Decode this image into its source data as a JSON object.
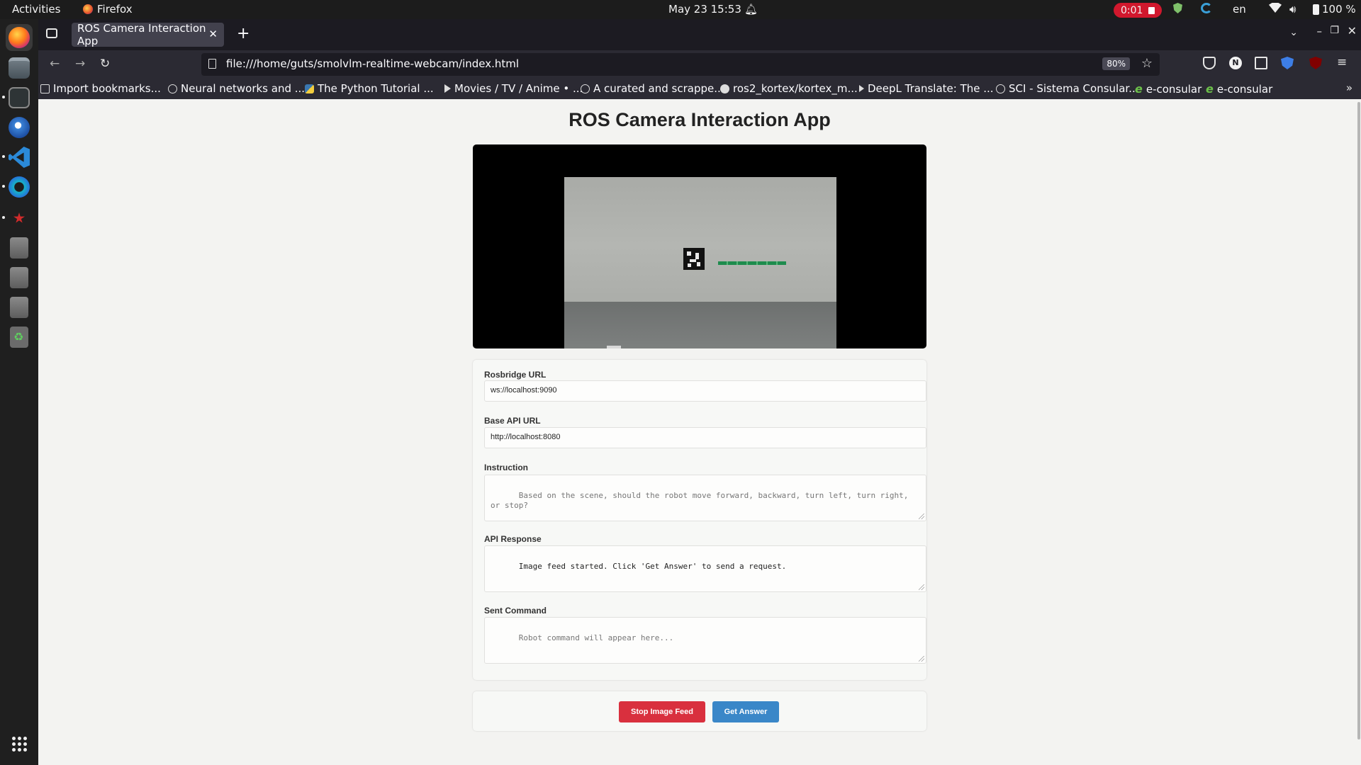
{
  "system": {
    "activities": "Activities",
    "app_name": "Firefox",
    "clock": "May 23  15:53",
    "recording": "0:01",
    "language": "en",
    "battery": "100 %"
  },
  "browser": {
    "tab_title": "ROS Camera Interaction App",
    "url": "file:///home/guts/smolvlm-realtime-webcam/index.html",
    "zoom": "80%",
    "ext_n": "N",
    "bookmarks": [
      "Import bookmarks...",
      "Neural networks and ...",
      "The Python Tutorial ...",
      "Movies / TV / Anime • ...",
      "A curated and scrappe...",
      "ros2_kortex/kortex_m...",
      "DeepL Translate: The ...",
      "SCI - Sistema Consular...",
      "e-consular",
      "e-consular"
    ]
  },
  "page": {
    "title": "ROS Camera Interaction App",
    "form": {
      "rosbridge_label": "Rosbridge URL",
      "rosbridge_value": "ws://localhost:9090",
      "api_label": "Base API URL",
      "api_value": "http://localhost:8080",
      "instruction_label": "Instruction",
      "instruction_placeholder": "Based on the scene, should the robot move forward, backward, turn left, turn right, or stop?",
      "response_label": "API Response",
      "response_value": "Image feed started. Click 'Get Answer' to send a request.",
      "command_label": "Sent Command",
      "command_placeholder": "Robot command will appear here..."
    },
    "buttons": {
      "stop": "Stop Image Feed",
      "answer": "Get Answer"
    }
  },
  "colors": {
    "stop_button": "#d9303e",
    "answer_button": "#3a87c8",
    "recording": "#d1182d"
  }
}
